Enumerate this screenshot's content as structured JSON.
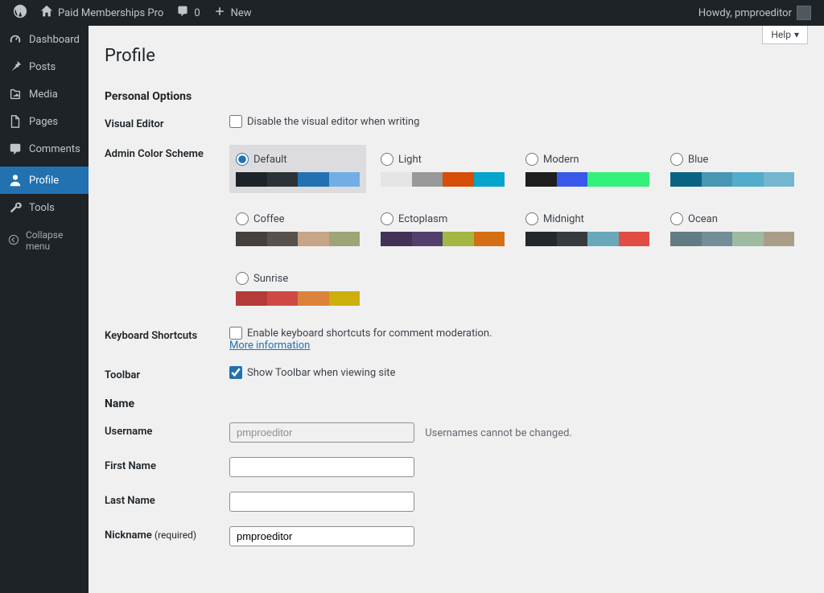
{
  "adminbar": {
    "site_name": "Paid Memberships Pro",
    "comment_count": "0",
    "new_label": "New",
    "howdy": "Howdy, pmproeditor"
  },
  "sidebar": {
    "items": [
      {
        "id": "dashboard",
        "label": "Dashboard",
        "icon": "dashboard-icon"
      },
      {
        "id": "posts",
        "label": "Posts",
        "icon": "pin-icon"
      },
      {
        "id": "media",
        "label": "Media",
        "icon": "media-icon"
      },
      {
        "id": "pages",
        "label": "Pages",
        "icon": "page-icon"
      },
      {
        "id": "comments",
        "label": "Comments",
        "icon": "comment-icon"
      },
      {
        "id": "profile",
        "label": "Profile",
        "icon": "user-icon",
        "current": true
      },
      {
        "id": "tools",
        "label": "Tools",
        "icon": "wrench-icon"
      }
    ],
    "collapse_label": "Collapse menu"
  },
  "help_label": "Help",
  "page_title": "Profile",
  "sections": {
    "personal_options": "Personal Options",
    "name": "Name"
  },
  "fields": {
    "visual_editor": {
      "label": "Visual Editor",
      "checkbox_label": "Disable the visual editor when writing",
      "checked": false
    },
    "color_scheme": {
      "label": "Admin Color Scheme",
      "selected": "default",
      "options": [
        {
          "id": "default",
          "label": "Default",
          "colors": [
            "#1d2327",
            "#2c3338",
            "#2271b1",
            "#72aee6"
          ]
        },
        {
          "id": "light",
          "label": "Light",
          "colors": [
            "#e5e5e5",
            "#999999",
            "#d64e07",
            "#04a4cc"
          ]
        },
        {
          "id": "modern",
          "label": "Modern",
          "colors": [
            "#1e1e1e",
            "#3858e9",
            "#33f078",
            "#33f078"
          ]
        },
        {
          "id": "blue",
          "label": "Blue",
          "colors": [
            "#096484",
            "#4796b3",
            "#52accc",
            "#74B6CE"
          ]
        },
        {
          "id": "coffee",
          "label": "Coffee",
          "colors": [
            "#46403c",
            "#59524c",
            "#c7a589",
            "#9ea476"
          ]
        },
        {
          "id": "ectoplasm",
          "label": "Ectoplasm",
          "colors": [
            "#413256",
            "#523f6d",
            "#a3b745",
            "#d46f15"
          ]
        },
        {
          "id": "midnight",
          "label": "Midnight",
          "colors": [
            "#25282b",
            "#363b3f",
            "#69a8bb",
            "#e14d43"
          ]
        },
        {
          "id": "ocean",
          "label": "Ocean",
          "colors": [
            "#627c83",
            "#738e96",
            "#9ebaa0",
            "#aa9d88"
          ]
        },
        {
          "id": "sunrise",
          "label": "Sunrise",
          "colors": [
            "#b43c38",
            "#cf4944",
            "#dd823b",
            "#ccaf0b"
          ]
        }
      ]
    },
    "keyboard": {
      "label": "Keyboard Shortcuts",
      "checkbox_label": "Enable keyboard shortcuts for comment moderation.",
      "more": "More information",
      "checked": false
    },
    "toolbar": {
      "label": "Toolbar",
      "checkbox_label": "Show Toolbar when viewing site",
      "checked": true
    },
    "username": {
      "label": "Username",
      "value": "pmproeditor",
      "note": "Usernames cannot be changed."
    },
    "first_name": {
      "label": "First Name",
      "value": ""
    },
    "last_name": {
      "label": "Last Name",
      "value": ""
    },
    "nickname": {
      "label": "Nickname",
      "required": "(required)",
      "value": "pmproeditor"
    }
  }
}
